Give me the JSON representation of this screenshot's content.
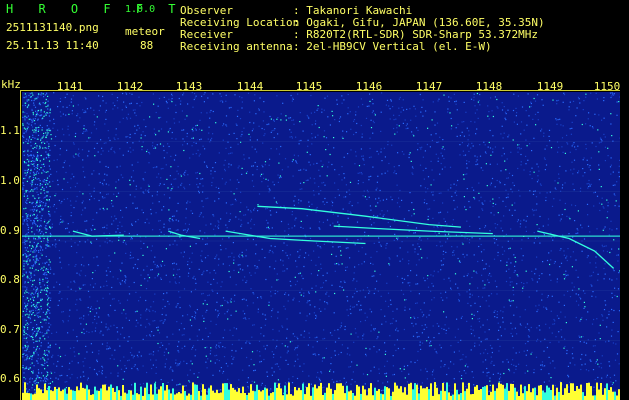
{
  "app": {
    "name": "H R O F F T",
    "version": "1.0.0"
  },
  "file": {
    "name": "2511131140.png",
    "date_time": "25.11.13 11:40"
  },
  "mode": {
    "label": "meteor",
    "count": "88"
  },
  "info": [
    {
      "key": "Observer",
      "value": ": Takanori Kawachi"
    },
    {
      "key": "Receiving Location",
      "value": ": Ogaki, Gifu, JAPAN (136.60E, 35.35N)"
    },
    {
      "key": "Receiver",
      "value": ": R820T2(RTL-SDR) SDR-Sharp 53.372MHz"
    },
    {
      "key": "Receiving antenna",
      "value": ": 2el-HB9CV Vertical (el. E-W)"
    }
  ],
  "chart_data": {
    "type": "heatmap",
    "ylabel": "kHz",
    "x_ticks": [
      "1141",
      "1142",
      "1143",
      "1144",
      "1145",
      "1146",
      "1147",
      "1148",
      "1149",
      "1150"
    ],
    "y_ticks": [
      "1.1",
      "1.0",
      "0.9",
      "0.8",
      "0.7",
      "0.6"
    ],
    "x_range": [
      1140.6,
      1150
    ],
    "y_range": [
      0.58,
      1.2
    ],
    "carrier_khz": 0.91,
    "traces": [
      {
        "points": [
          [
            1141.4,
            0.92
          ],
          [
            1141.7,
            0.91
          ],
          [
            1142.2,
            0.912
          ]
        ]
      },
      {
        "points": [
          [
            1142.9,
            0.92
          ],
          [
            1143.1,
            0.912
          ],
          [
            1143.4,
            0.905
          ]
        ]
      },
      {
        "points": [
          [
            1144.3,
            0.97
          ],
          [
            1145.0,
            0.965
          ],
          [
            1146.0,
            0.95
          ],
          [
            1147.0,
            0.933
          ],
          [
            1147.5,
            0.928
          ]
        ]
      },
      {
        "points": [
          [
            1145.5,
            0.93
          ],
          [
            1146.2,
            0.925
          ],
          [
            1147.0,
            0.92
          ],
          [
            1148.0,
            0.915
          ]
        ]
      },
      {
        "points": [
          [
            1148.7,
            0.92
          ],
          [
            1149.2,
            0.905
          ],
          [
            1149.6,
            0.88
          ],
          [
            1149.9,
            0.845
          ]
        ]
      },
      {
        "points": [
          [
            1143.8,
            0.92
          ],
          [
            1144.5,
            0.905
          ],
          [
            1145.2,
            0.9
          ],
          [
            1146.0,
            0.895
          ]
        ]
      }
    ],
    "colors": {
      "background": "#0a1a8c",
      "noise": "#2a6cff",
      "signal": "#33ffdd",
      "strong": "#ffff33",
      "hot": "#ff3366"
    }
  }
}
